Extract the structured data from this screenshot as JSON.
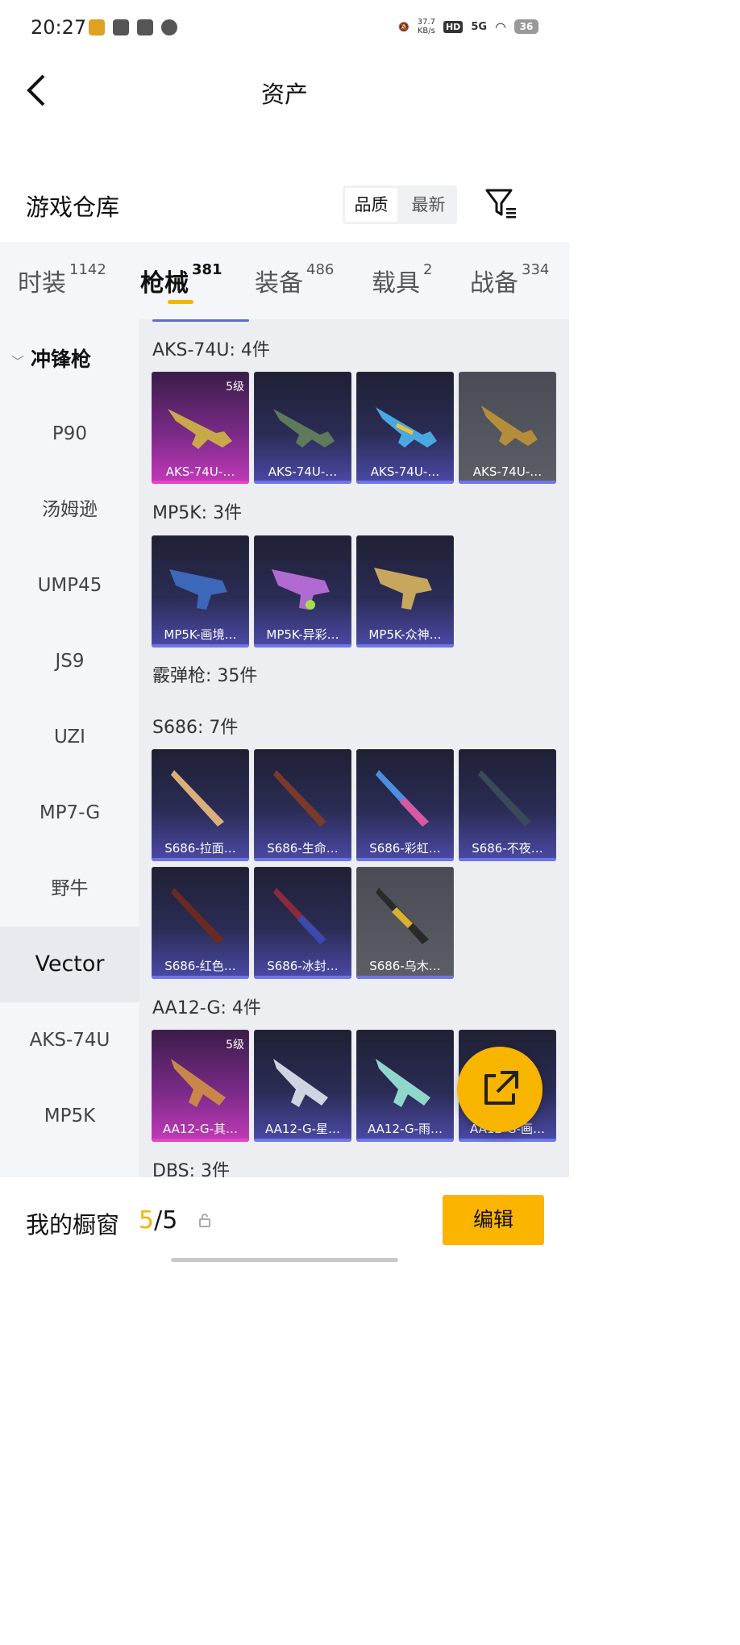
{
  "status_bar": {
    "time": "20:27",
    "speed_value": "37.7",
    "speed_unit": "KB/s",
    "network": "5G",
    "battery": "36",
    "hd_label": "HD"
  },
  "header": {
    "title": "资产"
  },
  "section": {
    "title": "游戏仓库",
    "sort_quality": "品质",
    "sort_newest": "最新"
  },
  "tabs": [
    {
      "label": "时装",
      "count": "1142"
    },
    {
      "label": "枪械",
      "count": "381"
    },
    {
      "label": "装备",
      "count": "486"
    },
    {
      "label": "载具",
      "count": "2"
    },
    {
      "label": "战备",
      "count": "334"
    }
  ],
  "sidebar": {
    "group": "冲锋枪",
    "items": [
      "P90",
      "汤姆逊",
      "UMP45",
      "JS9",
      "UZI",
      "MP7-G",
      "野牛",
      "Vector",
      "AKS-74U",
      "MP5K"
    ],
    "selected": "Vector"
  },
  "categories": {
    "aks": {
      "title": "AKS-74U: 4件",
      "items": [
        {
          "name": "AKS-74U-…",
          "level": "5级"
        },
        {
          "name": "AKS-74U-…"
        },
        {
          "name": "AKS-74U-…"
        },
        {
          "name": "AKS-74U-…"
        }
      ]
    },
    "mp5k": {
      "title": "MP5K: 3件",
      "items": [
        {
          "name": "MP5K-画境…"
        },
        {
          "name": "MP5K-异彩…"
        },
        {
          "name": "MP5K-众神…"
        }
      ]
    },
    "shotgun": {
      "title": "霰弹枪: 35件"
    },
    "s686": {
      "title": "S686: 7件",
      "items": [
        {
          "name": "S686-拉面…"
        },
        {
          "name": "S686-生命…"
        },
        {
          "name": "S686-彩虹…"
        },
        {
          "name": "S686-不夜…"
        },
        {
          "name": "S686-红色…"
        },
        {
          "name": "S686-冰封…"
        },
        {
          "name": "S686-乌木…"
        }
      ]
    },
    "aa12": {
      "title": "AA12-G: 4件",
      "items": [
        {
          "name": "AA12-G-其…",
          "level": "5级"
        },
        {
          "name": "AA12-G-星…"
        },
        {
          "name": "AA12-G-雨…"
        },
        {
          "name": "AA12-G-画…"
        }
      ]
    },
    "dbs": {
      "title": "DBS: 3件"
    }
  },
  "bottom": {
    "showcase_label": "我的橱窗",
    "showcase_current": "5",
    "showcase_sep": "/",
    "showcase_total": "5",
    "edit_label": "编辑"
  }
}
